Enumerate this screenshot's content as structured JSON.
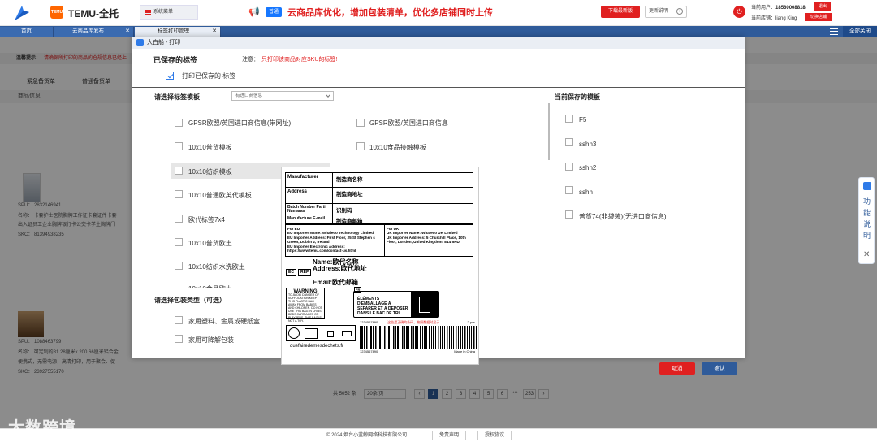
{
  "header": {
    "app_name": "TEMU-全托",
    "temu_logo_text": "TEMU",
    "system_menu": "系统菜单",
    "announce_tag": "普通",
    "announce_text": "云商品库优化，增加包装清单，优化多店铺同时上传",
    "download_button": "下载最新版",
    "update_button": "更新说明",
    "user_label": "当前用户：",
    "user_phone": "18560008818",
    "shop_label": "当前店铺：",
    "shop_name": "liang King",
    "logout_button": "退出",
    "switch_shop_button": "切换店铺"
  },
  "tabs": [
    {
      "label": "首页"
    },
    {
      "label": "云商品库发布"
    },
    {
      "label": "标签打印管理"
    }
  ],
  "close_all": "全部关闭",
  "background": {
    "tip_label": "温馨提示：",
    "tip_text": "请确保所打印的商品的仓规信息已经上",
    "tabs": [
      "紧急备货单",
      "普通备货单"
    ],
    "table_header": "商品信息",
    "product1": {
      "spu": "SPU： 2832146941",
      "name": "名称： 卡套护士医院胸牌工作证卡套证件卡套",
      "name2": "出入证员工企业胸牌银行卡公交卡学生胸牌门",
      "skc": "SKC： 81394938235"
    },
    "product2": {
      "spu": "SPU： 1088463799",
      "name": "名称： 可定制的81.28厘米x 200.66厘米铝合金",
      "name2": "便携式，无需电源，高清打印，用于聚会、促",
      "skc": "SKC： 23927555170"
    },
    "pager": {
      "total": "共 5052 条",
      "per_page": "20条/页",
      "pages": [
        "1",
        "2",
        "3",
        "4",
        "5",
        "6",
        "•••",
        "253"
      ],
      "prev": "‹",
      "next": "›"
    }
  },
  "modal": {
    "title": "大白船 - 打印",
    "saved_labels_title": "已保存的标签",
    "note_label": "注意：",
    "note_text": "只打印该商品对应SKU的标签!",
    "print_saved_label": "打印已保存的 标签",
    "print_saved_checked": true,
    "select_template_title": "请选择标签模板",
    "template_select_value": "有进口商信息",
    "templates_left": [
      "GPSR欧盟/英国进口商信息(带网址)",
      "10x10普货模板",
      "10x10纺织模板",
      "10x10普通欧英代模板",
      "欧代标签7x4",
      "10x10普货欧土",
      "10x10纺织水洗欧土",
      "10x10食品欧土"
    ],
    "templates_right": [
      "GPSR欧盟/英国进口商信息",
      "10x10食品接触模板"
    ],
    "current_saved_title": "当前保存的模板",
    "saved_templates": [
      "F5",
      "sshh3",
      "sshh2",
      "sshh",
      "普货74(非袋装)(无进口商信息)"
    ],
    "packaging_title": "请选择包装类型（可选）",
    "packaging_options": [
      "家用塑料、金属或硬纸盒",
      "家用可降解包装"
    ],
    "cancel_button": "取消",
    "confirm_button": "确认"
  },
  "preview": {
    "rows": [
      {
        "k": "Manufacturer",
        "v": "制造商名称"
      },
      {
        "k": "Address",
        "v": "制造商地址"
      },
      {
        "k": "Batch Number Parti Numaras",
        "v": "识别码"
      },
      {
        "k": "Manufacture E-mail",
        "v": "制造商邮箱"
      }
    ],
    "eu_importer": "For EU\nEU Importer Name: Whaleco Technology Limited\nEU Importer Address: First Floor, 25 St Stephen s Green, Dublin 2, Ireland\nEU Importer Electronic Address: https://www.temu.com/contact-us.html",
    "uk_importer": "For UK\nUK Importer Name: Whaleco UK Limited\nUK Importer Address: 5 Churchill Place, 10th Floor, London, United Kingdom, E14 5HU",
    "ec_tag": "EC",
    "rep_tag": "REP",
    "ec_name": "Name:欧代名称",
    "ec_address": "Address:欧代地址",
    "ec_email": "Email:欧代邮箱",
    "warning_title": "WARNING",
    "warning_text": "TO AVOID DANGER OF SUFFOCATION KEEP THIS PLASTIC BAG AWAY FROM BABIES AND CHILDREN. DO NOT USE THIS BAG IN CRIBS BEDS CARRIAGES OR PLAYPENS. THIS BAG IS NOT A TOY.",
    "triman_text": "ÉLÉMENTS D'EMBALLAGE À SÉPARER ET À DÉPOSER DANS LE BAC DE TRI",
    "fr_badge": "FR",
    "url": "quefairedemesdechets.fr",
    "barcode_number": "1234567890",
    "barcode_red": "这些是正确的条码，按照数据时显示",
    "barcode_qty": "2 pcs",
    "made_in": "Made in China"
  },
  "side_float": {
    "text": "功能说明",
    "close": "✕"
  },
  "footer": {
    "copyright": "© 2024 烟台小蓝鲸网络科技有限公司",
    "disclaimer": "免责声明",
    "license": "授权协议"
  },
  "watermark": "大数跨境"
}
